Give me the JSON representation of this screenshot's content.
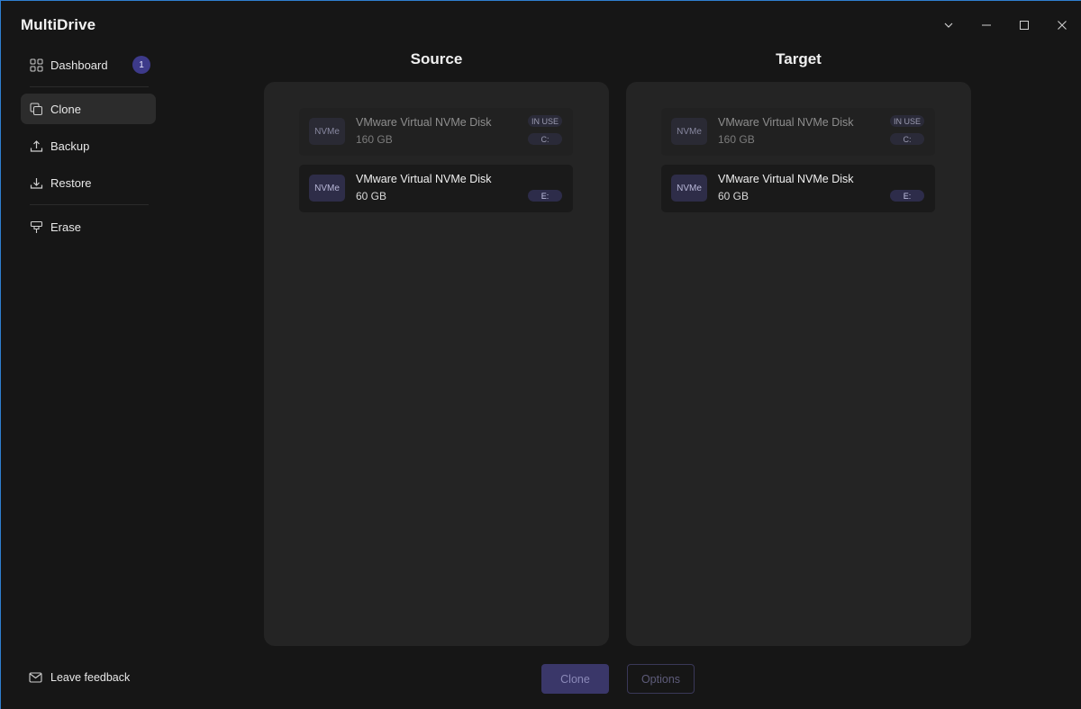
{
  "app": {
    "title": "MultiDrive"
  },
  "window_controls": [
    {
      "name": "collapse",
      "icon": "chevron-down-icon"
    },
    {
      "name": "minimize",
      "icon": "minimize-icon"
    },
    {
      "name": "maximize",
      "icon": "maximize-icon"
    },
    {
      "name": "close",
      "icon": "close-icon"
    }
  ],
  "sidebar": {
    "items": [
      {
        "label": "Dashboard",
        "icon": "dashboard-grid-icon",
        "badge": "1",
        "active": false
      },
      {
        "label": "Clone",
        "icon": "clone-icon",
        "active": true
      },
      {
        "label": "Backup",
        "icon": "upload-icon",
        "active": false
      },
      {
        "label": "Restore",
        "icon": "download-icon",
        "active": false
      },
      {
        "label": "Erase",
        "icon": "erase-icon",
        "active": false
      }
    ],
    "feedback": {
      "label": "Leave feedback",
      "icon": "mail-icon"
    }
  },
  "source": {
    "title": "Source",
    "disks": [
      {
        "type": "NVMe",
        "name": "VMware Virtual NVMe Disk",
        "size": "160 GB",
        "status": "IN USE",
        "drive": "C:",
        "disabled": true
      },
      {
        "type": "NVMe",
        "name": "VMware Virtual NVMe Disk",
        "size": "60 GB",
        "drive": "E:",
        "disabled": false
      }
    ]
  },
  "target": {
    "title": "Target",
    "disks": [
      {
        "type": "NVMe",
        "name": "VMware Virtual NVMe Disk",
        "size": "160 GB",
        "status": "IN USE",
        "drive": "C:",
        "disabled": true
      },
      {
        "type": "NVMe",
        "name": "VMware Virtual NVMe Disk",
        "size": "60 GB",
        "drive": "E:",
        "disabled": false
      }
    ]
  },
  "actions": {
    "clone_label": "Clone",
    "options_label": "Options"
  },
  "colors": {
    "accent": "#3d3a8a",
    "background": "#161616",
    "panel": "#242424"
  }
}
